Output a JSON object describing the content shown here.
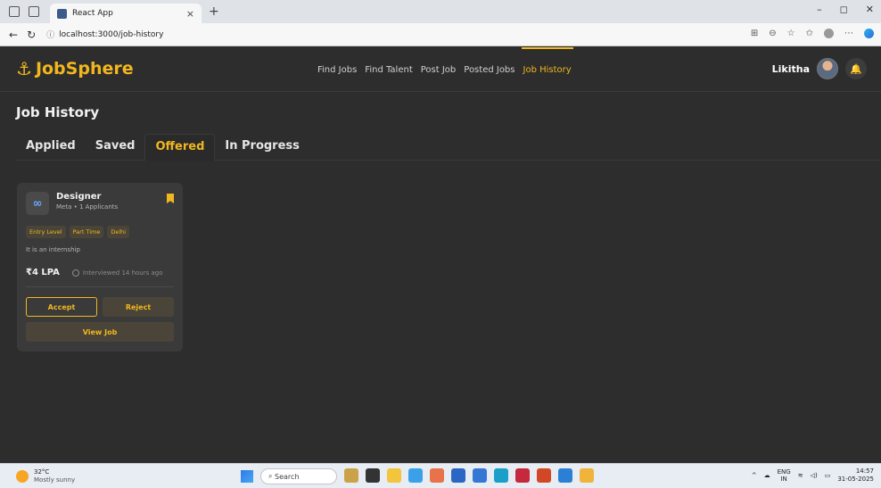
{
  "browser": {
    "tab_title": "React App",
    "tab_close": "×",
    "new_tab": "+",
    "url": "localhost:3000/job-history",
    "win_minimize": "–",
    "win_restore": "◻",
    "win_close": "✕"
  },
  "header": {
    "logo_text": "JobSphere",
    "nav": [
      {
        "label": "Find Jobs"
      },
      {
        "label": "Find Talent"
      },
      {
        "label": "Post Job"
      },
      {
        "label": "Posted Jobs"
      },
      {
        "label": "Job History"
      }
    ],
    "user_name": "Likitha"
  },
  "page": {
    "title": "Job History",
    "tabs": [
      {
        "label": "Applied"
      },
      {
        "label": "Saved"
      },
      {
        "label": "Offered"
      },
      {
        "label": "In Progress"
      }
    ]
  },
  "card": {
    "title": "Designer",
    "subtitle": "Meta • 1 Applicants",
    "tags": [
      "Entry Level",
      "Part Time",
      "Delhi"
    ],
    "description": "It is an internship",
    "salary": "₹4 LPA",
    "interviewed": "Interviewed 14 hours ago",
    "accept_label": "Accept",
    "reject_label": "Reject",
    "view_label": "View Job"
  },
  "taskbar": {
    "temperature": "32°C",
    "condition": "Mostly sunny",
    "search_placeholder": "Search",
    "lang_top": "ENG",
    "lang_bottom": "IN",
    "time": "14:57",
    "date": "31-05-2025"
  },
  "colors": {
    "accent": "#f2b71e",
    "background": "#2d2d2d",
    "card": "#3a3a3a"
  }
}
